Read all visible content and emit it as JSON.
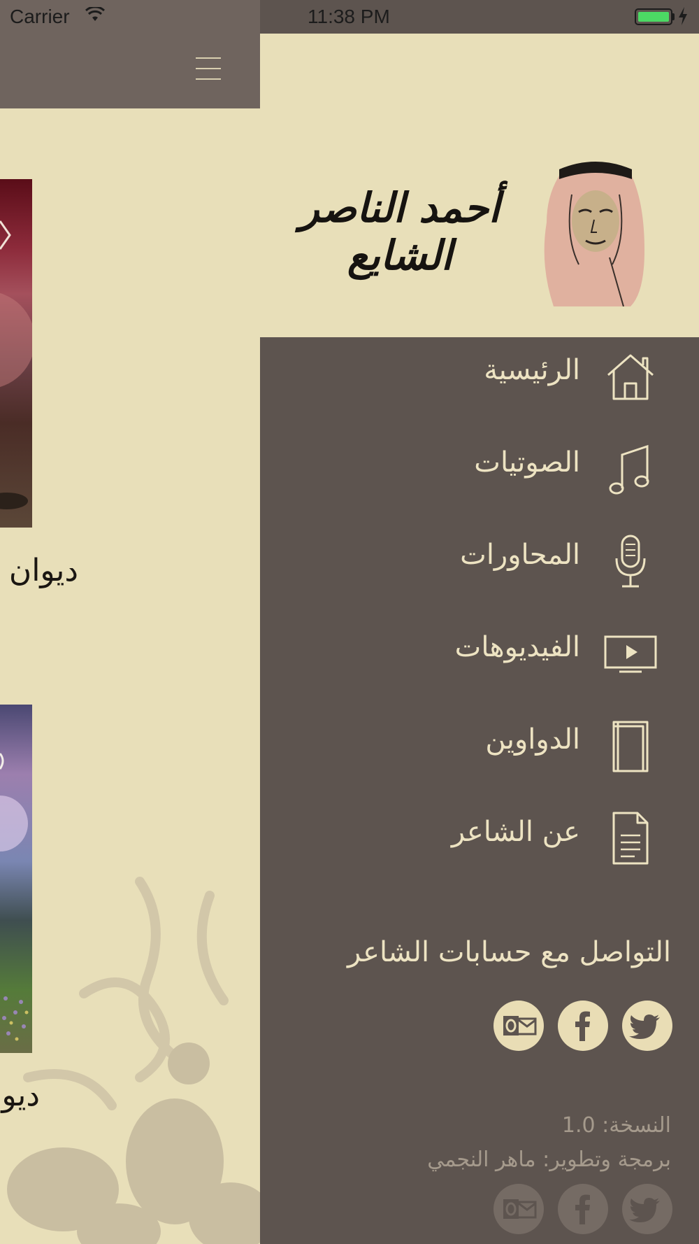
{
  "status_bar": {
    "carrier": "Carrier",
    "time": "11:38 PM"
  },
  "main": {
    "cards": [
      {
        "title": "ديوان"
      },
      {
        "title": "ديو"
      }
    ]
  },
  "drawer": {
    "logo_text": "أحمد الناصر الشايع",
    "menu": [
      {
        "label": "الرئيسية",
        "icon": "home-icon"
      },
      {
        "label": "الصوتيات",
        "icon": "music-note-icon"
      },
      {
        "label": "المحاورات",
        "icon": "microphone-icon"
      },
      {
        "label": "الفيديوهات",
        "icon": "video-icon"
      },
      {
        "label": "الدواوين",
        "icon": "book-icon"
      },
      {
        "label": "عن الشاعر",
        "icon": "document-icon"
      }
    ],
    "social_title": "التواصل مع حسابات الشاعر",
    "social_icons": [
      "twitter-icon",
      "facebook-icon",
      "outlook-icon"
    ],
    "version": "النسخة: 1.0",
    "credits": "برمجة وتطوير: ماهر النجمي",
    "developer_social_icons": [
      "twitter-icon",
      "facebook-icon",
      "outlook-icon"
    ]
  },
  "colors": {
    "drawer_bg": "#5d544f",
    "cream": "#e8dfb9",
    "menu_text": "#ede3c2",
    "battery_green": "#4cd964"
  }
}
